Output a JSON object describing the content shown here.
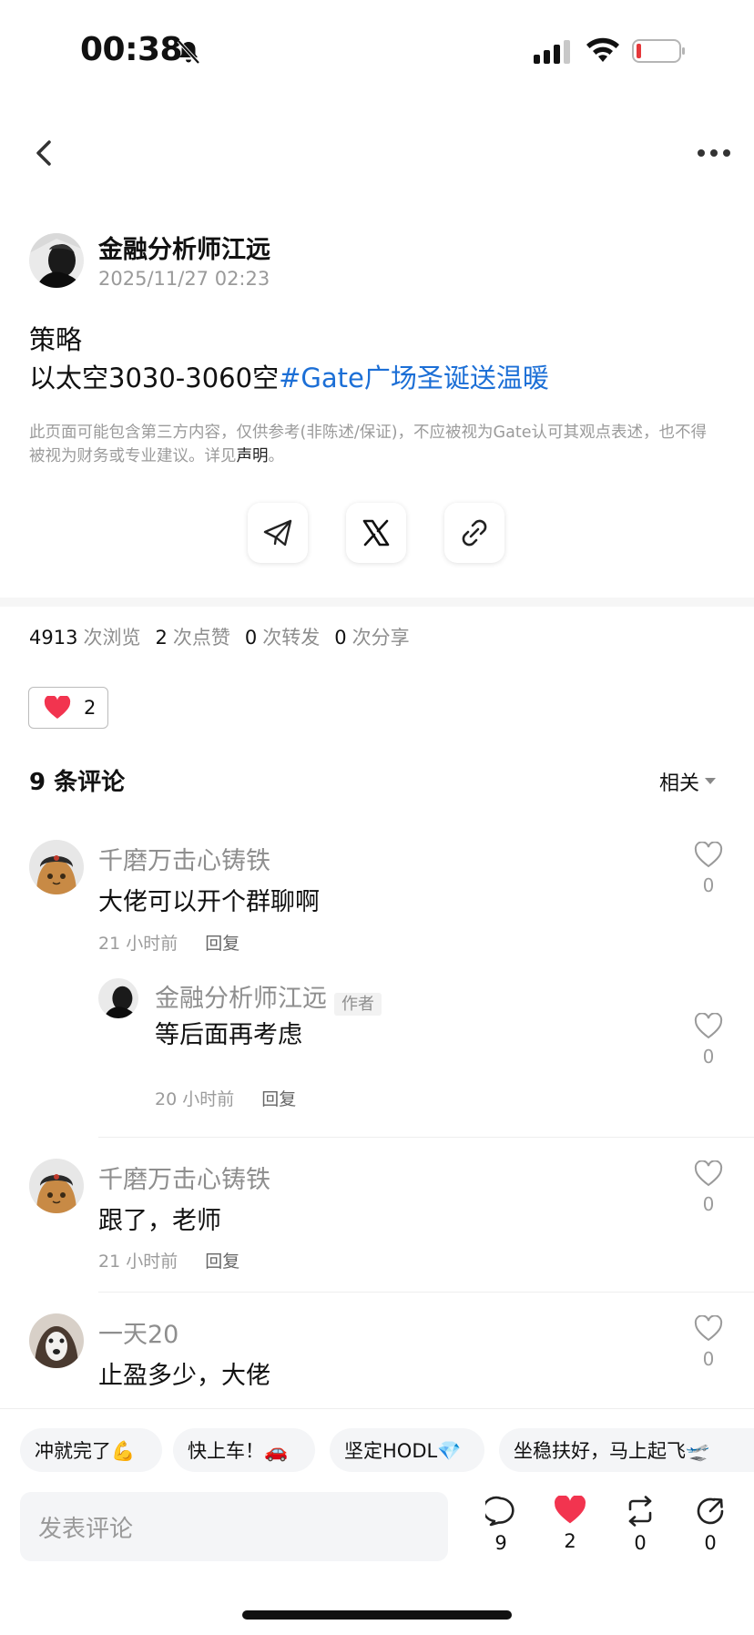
{
  "status_bar": {
    "time": "00:38"
  },
  "post": {
    "author": "金融分析师江远",
    "time": "2025/11/27 02:23",
    "title": "策略",
    "body": "以太空3030-3060空",
    "hashtag": "#Gate广场圣诞送温暖",
    "disclaimer": "此页面可能包含第三方内容，仅供参考(非陈述/保证)，不应被视为Gate认可其观点表述，也不得被视为财务或专业建议。详见",
    "disclaimer_link": "声明",
    "disclaimer_end": "。"
  },
  "share_icons": [
    "telegram-icon",
    "x-icon",
    "link-icon"
  ],
  "stats": {
    "views": "4913",
    "views_label": "次浏览",
    "likes": "2",
    "likes_label": "次点赞",
    "reposts": "0",
    "reposts_label": "次转发",
    "shares": "0",
    "shares_label": "次分享"
  },
  "reaction": {
    "count": "2"
  },
  "comments_header": {
    "title": "9 条评论",
    "sort": "相关"
  },
  "comments": [
    {
      "name": "千磨万击心铸铁",
      "text": "大佬可以开个群聊啊",
      "time": "21 小时前",
      "reply": "回复",
      "likes": "0",
      "replies": [
        {
          "name": "金融分析师江远",
          "tag": "作者",
          "text": "等后面再考虑",
          "time": "20 小时前",
          "reply": "回复",
          "likes": "0"
        }
      ]
    },
    {
      "name": "千磨万击心铸铁",
      "text": "跟了，老师",
      "time": "21 小时前",
      "reply": "回复",
      "likes": "0"
    },
    {
      "name": "一天20",
      "text": "止盈多少，大佬",
      "time": "",
      "reply": "",
      "likes": "0"
    }
  ],
  "quick_replies": [
    "冲就完了💪",
    "快上车！🚗",
    "坚定HODL💎",
    "坐稳扶好，马上起飞🛫"
  ],
  "comment_input": {
    "placeholder": "发表评论"
  },
  "actions": {
    "comments": "9",
    "likes": "2",
    "reposts": "0",
    "shares": "0"
  },
  "colors": {
    "accent_link": "#1c6fd6",
    "like_red": "#f2344f"
  }
}
